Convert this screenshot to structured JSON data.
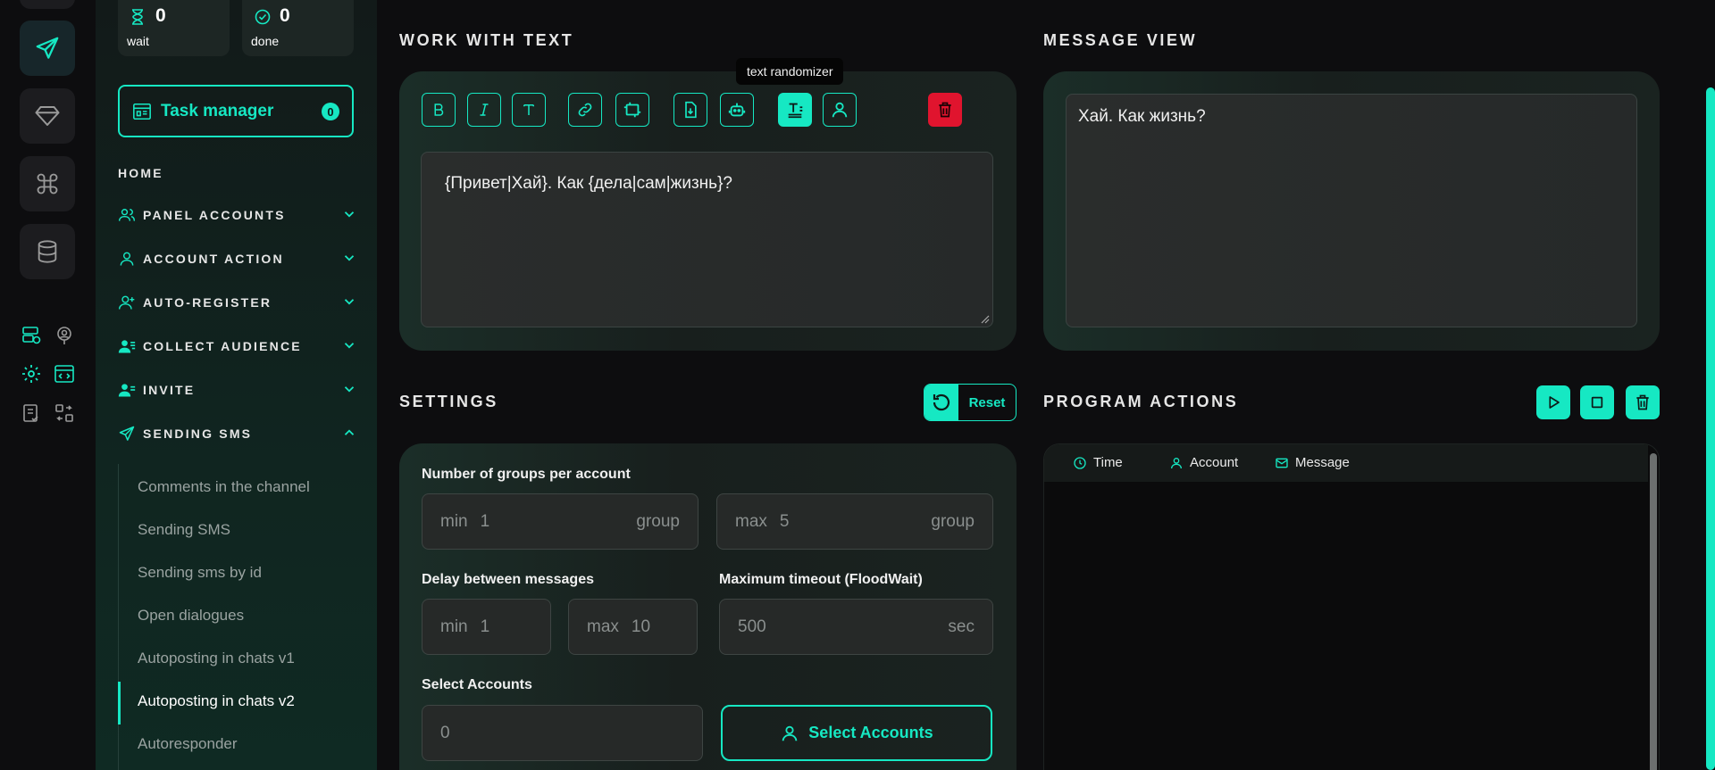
{
  "rail": {
    "buttons": [
      "send-icon",
      "diamond-icon",
      "command-icon",
      "database-icon"
    ],
    "small": [
      "server-check-icon",
      "user-target-icon",
      "gear-icon",
      "code-window-icon",
      "checklist-icon",
      "swap-icon"
    ]
  },
  "counters": {
    "wait": {
      "value": "0",
      "label": "wait"
    },
    "done": {
      "value": "0",
      "label": "done"
    }
  },
  "task_manager": {
    "label": "Task manager",
    "badge": "0"
  },
  "nav": {
    "home": "HOME",
    "sections": [
      {
        "label": "PANEL ACCOUNTS",
        "icon": "users-icon",
        "expanded": false
      },
      {
        "label": "ACCOUNT ACTION",
        "icon": "user-icon",
        "expanded": false
      },
      {
        "label": "AUTO-REGISTER",
        "icon": "user-plus-icon",
        "expanded": false
      },
      {
        "label": "COLLECT AUDIENCE",
        "icon": "user-list-icon",
        "expanded": false
      },
      {
        "label": "INVITE",
        "icon": "user-invite-icon",
        "expanded": false
      },
      {
        "label": "SENDING SMS",
        "icon": "send-icon",
        "expanded": true
      }
    ],
    "sub_items": [
      "Comments in the channel",
      "Sending SMS",
      "Sending sms by id",
      "Open dialogues",
      "Autoposting in chats v1",
      "Autoposting in chats v2",
      "Autoresponder"
    ],
    "active_sub": "Autoposting in chats v2"
  },
  "work_with_text": {
    "title": "WORK WITH TEXT",
    "tooltip": "text randomizer",
    "text": "{Привет|Хай}. Как {дела|сам|жизнь}?"
  },
  "message_view": {
    "title": "MESSAGE VIEW",
    "text": "Хай. Как жизнь?"
  },
  "settings": {
    "title": "SETTINGS",
    "reset_label": "Reset",
    "groups_label": "Number of groups per account",
    "groups_min": {
      "prefix": "min",
      "value": "1",
      "unit": "group"
    },
    "groups_max": {
      "prefix": "max",
      "value": "5",
      "unit": "group"
    },
    "delay_label": "Delay between messages",
    "delay_min": {
      "prefix": "min",
      "value": "1"
    },
    "delay_max": {
      "prefix": "max",
      "value": "10"
    },
    "timeout_label": "Maximum timeout (FloodWait)",
    "timeout": {
      "value": "500",
      "unit": "sec"
    },
    "accounts_label": "Select Accounts",
    "accounts_value": "0",
    "select_button": "Select Accounts"
  },
  "program_actions": {
    "title": "PROGRAM ACTIONS",
    "columns": [
      "Time",
      "Account",
      "Message"
    ]
  },
  "colors": {
    "accent": "#16e8c3",
    "danger": "#e0142e",
    "background": "#0d0d0f"
  }
}
